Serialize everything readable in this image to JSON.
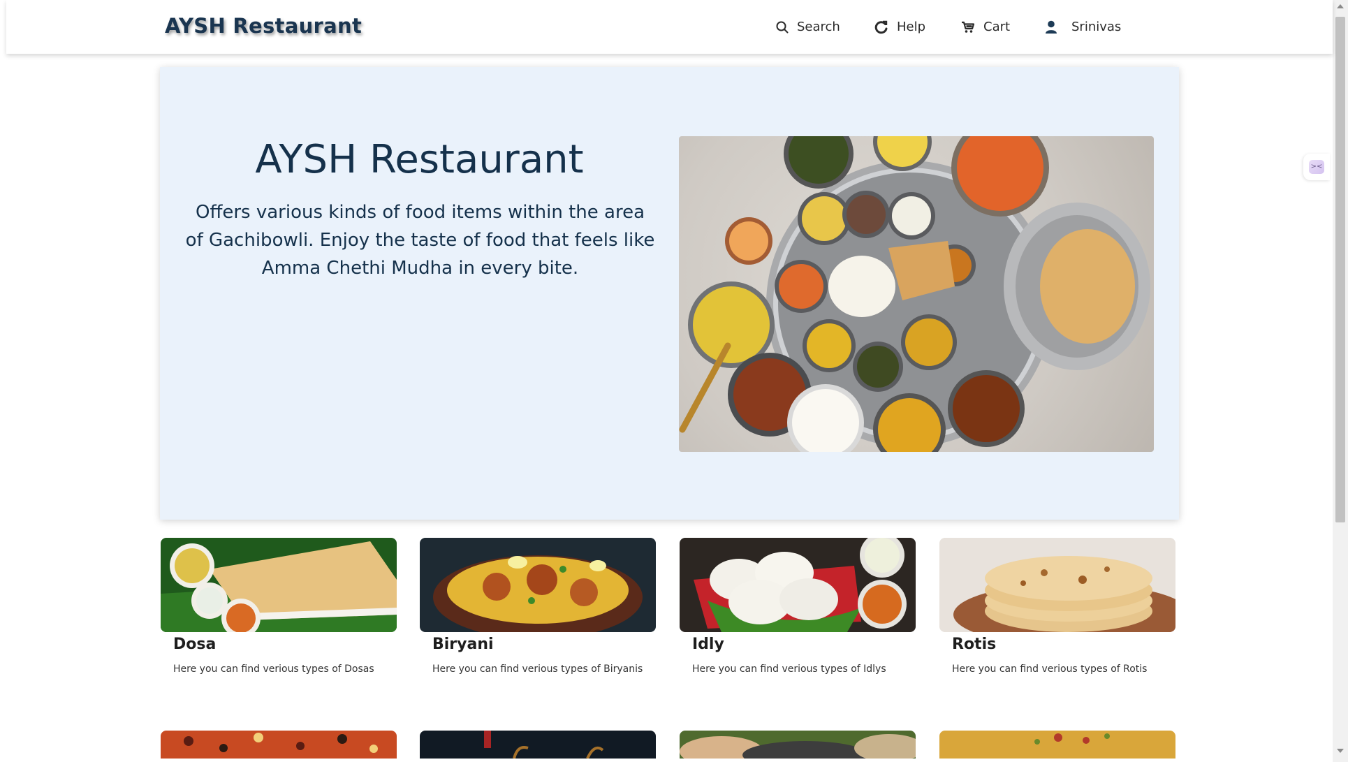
{
  "header": {
    "brand": "AYSH Restaurant",
    "nav": [
      {
        "label": "Search",
        "icon": "search-icon"
      },
      {
        "label": "Help",
        "icon": "help-icon"
      },
      {
        "label": "Cart",
        "icon": "cart-icon"
      },
      {
        "label": "Srinivas",
        "icon": "user-icon"
      }
    ]
  },
  "hero": {
    "title": "AYSH Restaurant",
    "description": "Offers various kinds of food items within the area of Gachibowli. Enjoy the taste of food that feels like Amma Chethi Mudha in every bite.",
    "image": "indian-thali-image"
  },
  "cards": [
    {
      "title": "Dosa",
      "description": "Here you can find verious types of Dosas",
      "image": "dosa-image"
    },
    {
      "title": "Biryani",
      "description": "Here you can find verious types of Biryanis",
      "image": "biryani-image"
    },
    {
      "title": "Idly",
      "description": "Here you can find verious types of Idlys",
      "image": "idly-image"
    },
    {
      "title": "Rotis",
      "description": "Here you can find verious types of Rotis",
      "image": "rotis-image"
    }
  ],
  "partial_cards": [
    "pizza-image",
    "drinks-image",
    "thali-image",
    "fried-rice-image"
  ],
  "colors": {
    "brand": "#1a3550",
    "hero_background": "#eaf2fb",
    "page_background": "#ffffff"
  }
}
